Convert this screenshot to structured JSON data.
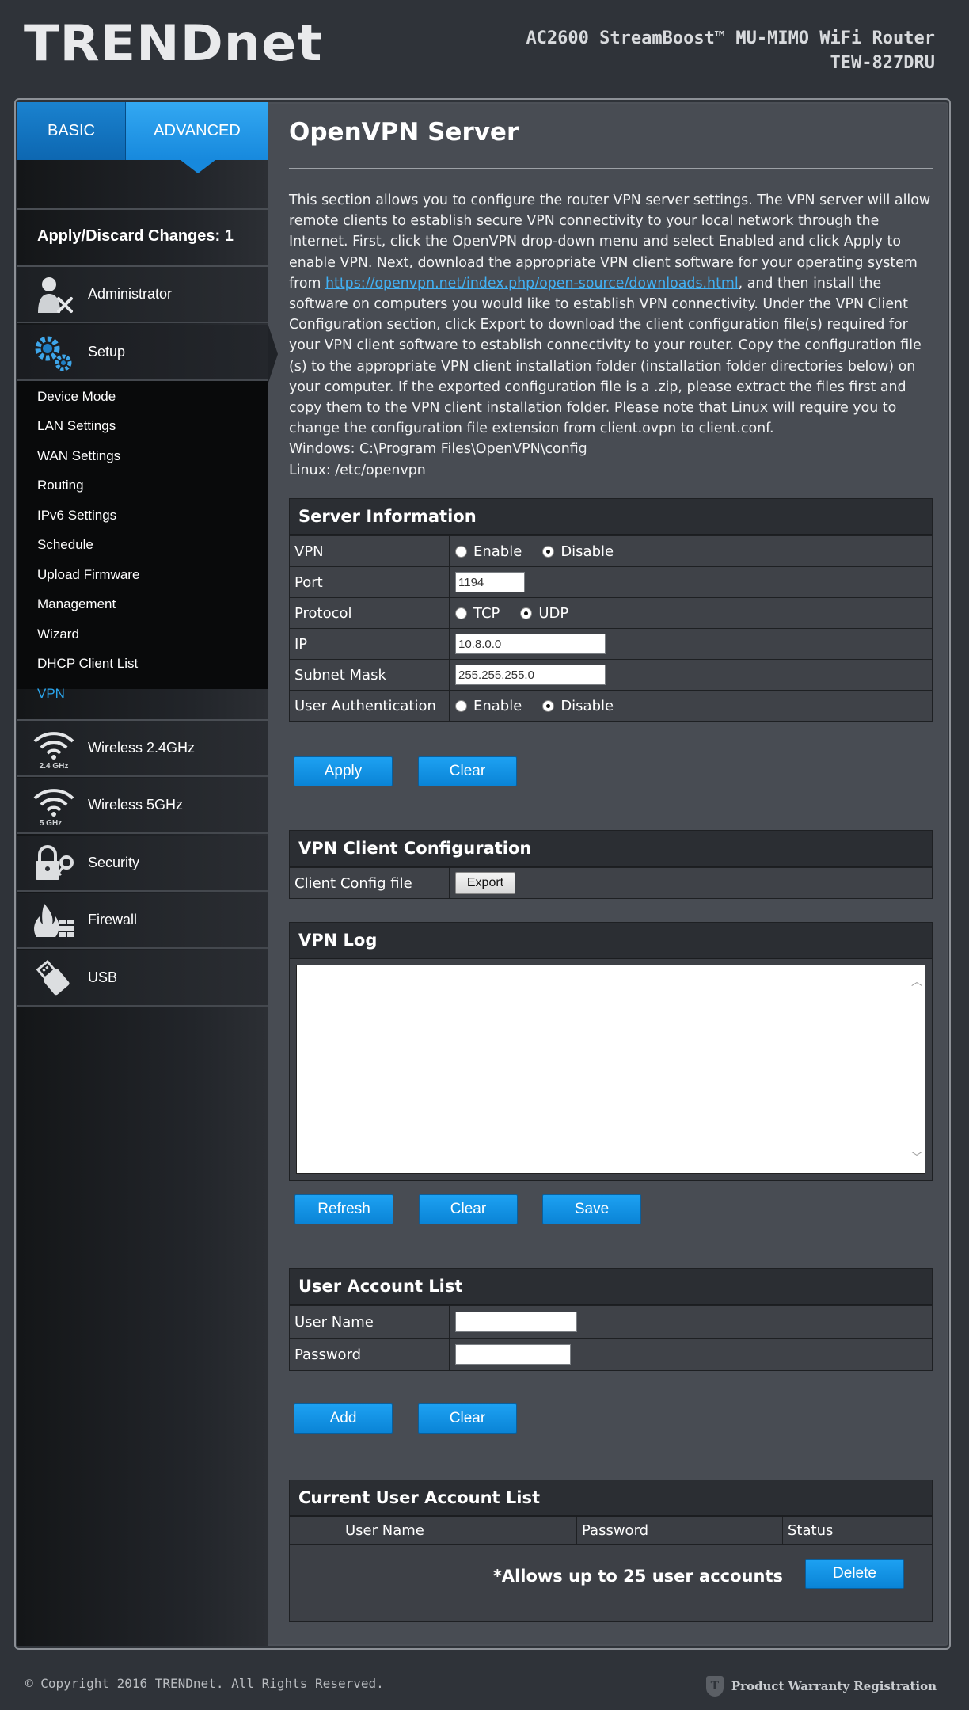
{
  "header": {
    "logo": "TRENDnet",
    "product_line": "AC2600 StreamBoost™ MU-MIMO WiFi Router",
    "model": "TEW-827DRU"
  },
  "tabs": {
    "basic": "BASIC",
    "advanced": "ADVANCED"
  },
  "sidebar": {
    "apply_changes": "Apply/Discard Changes: 1",
    "menu": [
      {
        "label": "Administrator",
        "icon": "administrator-icon"
      },
      {
        "label": "Setup",
        "icon": "gears-icon"
      },
      {
        "label": "Wireless 2.4GHz",
        "icon": "wifi-24-icon",
        "sub": "2.4 GHz"
      },
      {
        "label": "Wireless 5GHz",
        "icon": "wifi-5-icon",
        "sub": "5 GHz"
      },
      {
        "label": "Security",
        "icon": "lock-key-icon"
      },
      {
        "label": "Firewall",
        "icon": "firewall-icon"
      },
      {
        "label": "USB",
        "icon": "usb-icon"
      }
    ],
    "setup_items": [
      "Device Mode",
      "LAN Settings",
      "WAN Settings",
      "Routing",
      "IPv6 Settings",
      "Schedule",
      "Upload Firmware",
      "Management",
      "Wizard",
      "DHCP Client List",
      "VPN"
    ],
    "active_item": "VPN"
  },
  "main": {
    "title": "OpenVPN Server",
    "desc_part1": "This section allows you to configure the router VPN server settings. The VPN server will allow remote clients to establish secure VPN connectivity to your local network through the Internet. First, click the OpenVPN drop-down menu and select Enabled and click Apply to enable VPN. Next, download the appropriate VPN client software for your operating system from ",
    "desc_link": "https://openvpn.net/index.php/open-source/downloads.html",
    "desc_part2": ", and then install the software on computers you would like to establish VPN connectivity. Under the VPN Client Configuration section, click Export to download the client configuration file(s) required for your VPN client software to establish connectivity to your router. Copy the configuration file (s) to the appropriate VPN client installation folder (installation folder directories below) on your computer. If the exported configuration file is a .zip, please extract the files first and copy them to the VPN client installation folder. Please note that Linux will require you to change the configuration file extension from client.ovpn to client.conf.",
    "windows_path": "Windows: C:\\Program Files\\OpenVPN\\config",
    "linux_path": "Linux: /etc/openvpn"
  },
  "server_info": {
    "heading": "Server Information",
    "vpn_label": "VPN",
    "vpn_enable": "Enable",
    "vpn_disable": "Disable",
    "port_label": "Port",
    "port_value": "1194",
    "protocol_label": "Protocol",
    "protocol_tcp": "TCP",
    "protocol_udp": "UDP",
    "ip_label": "IP",
    "ip_value": "10.8.0.0",
    "subnet_label": "Subnet Mask",
    "subnet_value": "255.255.255.0",
    "auth_label": "User Authentication",
    "auth_enable": "Enable",
    "auth_disable": "Disable",
    "apply_button": "Apply",
    "clear_button": "Clear"
  },
  "client_config": {
    "heading": "VPN Client Configuration",
    "file_label": "Client Config file",
    "export_button": "Export"
  },
  "vpn_log": {
    "heading": "VPN Log",
    "refresh_button": "Refresh",
    "clear_button": "Clear",
    "save_button": "Save"
  },
  "user_account": {
    "heading": "User Account List",
    "username_label": "User Name",
    "password_label": "Password",
    "add_button": "Add",
    "clear_button": "Clear"
  },
  "current_users": {
    "heading": "Current User Account List",
    "col_username": "User Name",
    "col_password": "Password",
    "col_status": "Status",
    "note": "*Allows up to 25 user accounts",
    "delete_button": "Delete"
  },
  "footer": {
    "copyright": "© Copyright 2016 TRENDnet. All Rights Reserved.",
    "warranty": "Product Warranty Registration"
  },
  "colors": {
    "accent": "#1789dd",
    "active_link": "#2aa6ee",
    "background": "#2f3339"
  }
}
